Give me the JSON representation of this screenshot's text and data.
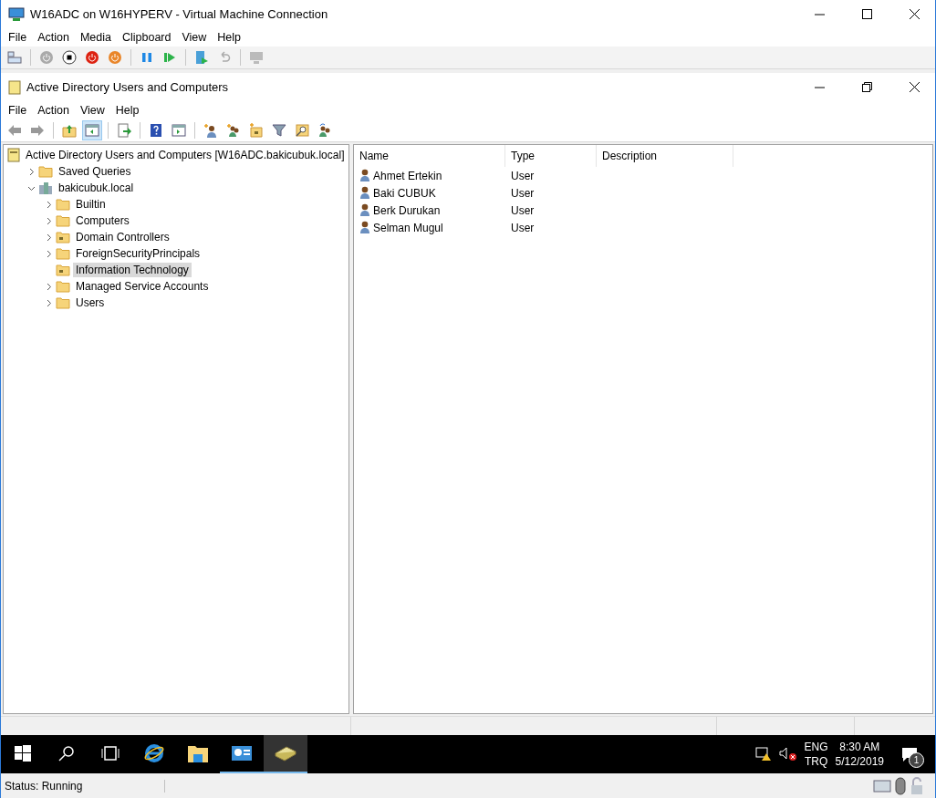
{
  "window": {
    "title": "W16ADC on W16HYPERV - Virtual Machine Connection"
  },
  "menu": [
    "File",
    "Action",
    "Media",
    "Clipboard",
    "View",
    "Help"
  ],
  "vm_toolbar": [
    {
      "kind": "ctrlaltdel"
    },
    {
      "kind": "sep"
    },
    {
      "kind": "start"
    },
    {
      "kind": "turnoff"
    },
    {
      "kind": "shutdown"
    },
    {
      "kind": "save"
    },
    {
      "kind": "sep"
    },
    {
      "kind": "pause"
    },
    {
      "kind": "resume"
    },
    {
      "kind": "sep"
    },
    {
      "kind": "checkpoint"
    },
    {
      "kind": "revert"
    },
    {
      "kind": "sep"
    },
    {
      "kind": "enhanced"
    }
  ],
  "console": {
    "title": "Active Directory Users and Computers",
    "menu": [
      "File",
      "Action",
      "View",
      "Help"
    ],
    "toolbar": [
      {
        "kind": "back",
        "selected": false
      },
      {
        "kind": "forward",
        "selected": false
      },
      {
        "kind": "sep"
      },
      {
        "kind": "upfolder",
        "selected": false
      },
      {
        "kind": "tree",
        "selected": true
      },
      {
        "kind": "sep"
      },
      {
        "kind": "export",
        "selected": false
      },
      {
        "kind": "sep"
      },
      {
        "kind": "help",
        "selected": false
      },
      {
        "kind": "pane",
        "selected": false
      },
      {
        "kind": "sep"
      },
      {
        "kind": "newuser",
        "selected": false
      },
      {
        "kind": "newgroup",
        "selected": false
      },
      {
        "kind": "newou",
        "selected": false
      },
      {
        "kind": "filter",
        "selected": false
      },
      {
        "kind": "find",
        "selected": false
      },
      {
        "kind": "addgroup",
        "selected": false
      }
    ],
    "tree": {
      "label": "Active Directory Users and Computers [W16ADC.bakicubuk.local]",
      "kind": "root",
      "children": [
        {
          "label": "Saved Queries",
          "kind": "folder",
          "expanded": false,
          "selected": false
        },
        {
          "label": "bakicubuk.local",
          "kind": "domain",
          "expanded": true,
          "selected": false,
          "children": [
            {
              "label": "Builtin",
              "kind": "folder",
              "expanded": false,
              "selected": false
            },
            {
              "label": "Computers",
              "kind": "folder",
              "expanded": false,
              "selected": false
            },
            {
              "label": "Domain Controllers",
              "kind": "ou",
              "expanded": false,
              "selected": false
            },
            {
              "label": "ForeignSecurityPrincipals",
              "kind": "folder",
              "expanded": false,
              "selected": false
            },
            {
              "label": "Information Technology",
              "kind": "ou",
              "selected": true
            },
            {
              "label": "Managed Service Accounts",
              "kind": "folder",
              "expanded": false,
              "selected": false
            },
            {
              "label": "Users",
              "kind": "folder",
              "expanded": false,
              "selected": false
            }
          ]
        }
      ]
    },
    "table": {
      "columns": [
        "Name",
        "Type",
        "Description"
      ],
      "rows": [
        [
          "Ahmet Ertekin",
          "User"
        ],
        [
          "Baki CUBUK",
          "User"
        ],
        [
          "Berk Durukan",
          "User"
        ],
        [
          "Selman Mugul",
          "User"
        ]
      ]
    }
  },
  "taskbar": {
    "apps": [
      {
        "kind": "ie",
        "running": false,
        "selected": false
      },
      {
        "kind": "explorer",
        "running": false,
        "selected": false
      },
      {
        "kind": "servermanager",
        "running": true,
        "selected": false
      },
      {
        "kind": "aduc",
        "running": true,
        "selected": true
      }
    ],
    "language": "ENG",
    "layout": "TRQ",
    "time": "8:30 AM",
    "date": "5/12/2019",
    "notifications": "1"
  },
  "status_bar": "Status: Running"
}
